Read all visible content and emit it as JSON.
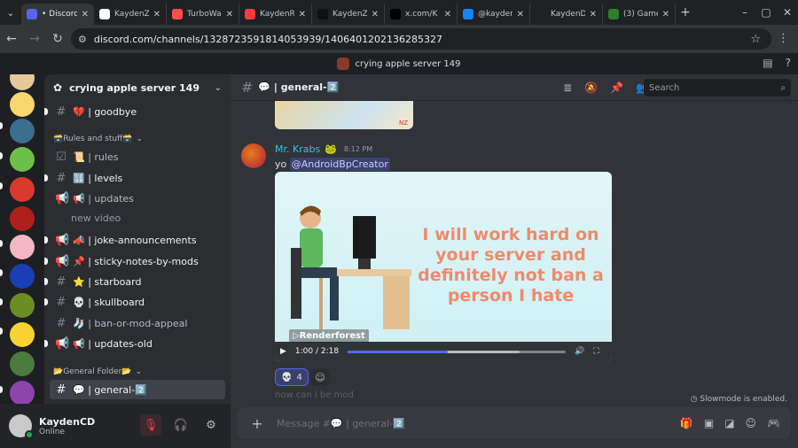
{
  "browser": {
    "tabs": [
      {
        "title": "• Discord",
        "favicon": "discord-icon",
        "color": "#5865f2",
        "active": true
      },
      {
        "title": "KaydenZ",
        "favicon": "kaydenz-icon",
        "color": "#ffffff",
        "active": false
      },
      {
        "title": "TurboWa",
        "favicon": "turbowarp-icon",
        "color": "#ff4c4c",
        "active": false
      },
      {
        "title": "KaydenR",
        "favicon": "kaydenr-icon",
        "color": "#ff3b3b",
        "active": false
      },
      {
        "title": "KaydenZ",
        "favicon": "tiktok-icon",
        "color": "#111111",
        "active": false
      },
      {
        "title": "x.com/K",
        "favicon": "x-icon",
        "color": "#000000",
        "active": false
      },
      {
        "title": "@kayden",
        "favicon": "bluesky-icon",
        "color": "#1185fe",
        "active": false
      },
      {
        "title": "KaydenD",
        "favicon": "kaydend-icon",
        "color": "#222222",
        "active": false
      },
      {
        "title": "(3) Game",
        "favicon": "game-icon",
        "color": "#2e7d32",
        "active": false
      }
    ],
    "url": "discord.com/channels/1328723591814053939/1406401202136285327"
  },
  "app": {
    "window_title": "crying apple server 149"
  },
  "server": {
    "name": "crying apple server 149"
  },
  "channels": {
    "goodbye": "💔 | goodbye",
    "cat_rules": "🗃️Rules and stuff🗃️",
    "rules": "📜 | rules",
    "levels": "🔢 | levels",
    "updates": "📢 | updates",
    "thread_new_video": "new video",
    "joke": "📣 | joke-announcements",
    "sticky": "📌 | sticky-notes-by-mods",
    "starboard": "⭐ | starboard",
    "skullboard": "💀 | skullboard",
    "ban_appeal": "🧦 | ban-or-mod-appeal",
    "updates_old": "📢 | updates-old",
    "cat_general": "📂General Folder📂",
    "general": "💬 | general-2️⃣"
  },
  "user": {
    "name": "KaydenCD",
    "status": "Online"
  },
  "chat": {
    "channel_title": "💬 | general-2️⃣",
    "search_placeholder": "Search",
    "message": {
      "author": "Mr. Krabs",
      "badge": "🐸",
      "time": "8:12 PM",
      "text_prefix": "yo",
      "mention": "@AndroidBpCreator"
    },
    "video": {
      "caption": "I will work hard on your server and definitely not ban a person I hate",
      "watermark": "▷Renderforest",
      "time": "1:00 / 2:18",
      "progress": 0.4587
    },
    "reaction": {
      "emoji": "💀",
      "count": "4"
    },
    "next_message_preview": "now can i be mod",
    "slowmode": "Slowmode is enabled.",
    "composer_placeholder": "Message #💬 | general-2️⃣"
  }
}
